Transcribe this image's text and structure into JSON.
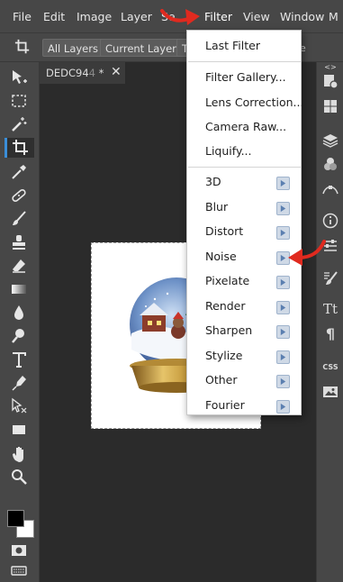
{
  "menubar": {
    "items": [
      "File",
      "Edit",
      "Image",
      "Layer",
      "Se",
      "Filter",
      "View",
      "Window",
      "M"
    ]
  },
  "options_bar": {
    "chips": [
      "All Layers",
      "Current Layer",
      "T"
    ],
    "trailing_text": "e"
  },
  "document": {
    "tab_name": "DEDC94",
    "tab_faded": "4",
    "tab_modified": "*",
    "close_glyph": "✕"
  },
  "filter_menu": {
    "top_items": [
      "Last Filter",
      "Filter Gallery...",
      "Lens Correction...",
      "Camera Raw...",
      "Liquify..."
    ],
    "submenus": [
      "3D",
      "Blur",
      "Distort",
      "Noise",
      "Pixelate",
      "Render",
      "Sharpen",
      "Stylize",
      "Other",
      "Fourier"
    ]
  },
  "right_panel": {
    "expand_glyph": "<>",
    "text_icon": "Tt",
    "paragraph_icon": "¶",
    "css_label": "CSS"
  },
  "colors": {
    "chrome": "#474747",
    "workspace": "#2b2b2b",
    "menu_bg": "#ffffff",
    "selected_tool_accent": "#3b8ed8",
    "annotation_arrow": "#e02a1f",
    "submenu_arrow_bg": "#cfd9e6"
  },
  "annotations": {
    "arrows": [
      "red-arrow-pointing-to-filter-menu",
      "red-arrow-pointing-to-noise-submenu"
    ]
  },
  "canvas_image": "snow-globe-winter-scene"
}
